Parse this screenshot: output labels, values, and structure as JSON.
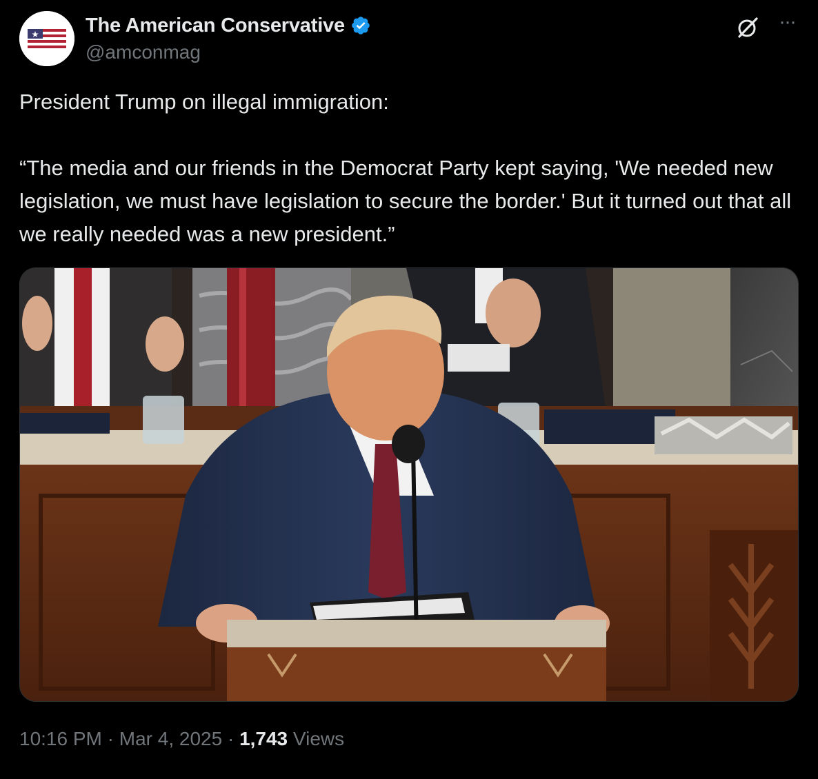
{
  "account": {
    "display_name": "The American Conservative",
    "handle": "@amconmag",
    "verified_badge_color": "#1d9bf0",
    "avatar_icon": "american-flag-logo"
  },
  "header_actions": {
    "grok_icon": "grok-icon",
    "more_icon": "more-options-icon",
    "more_label": "···"
  },
  "tweet": {
    "line1": "President Trump on illegal immigration:",
    "quote": "“The media and our friends in the Democrat Party kept saying, 'We needed new legislation, we must have legislation to secure the border.' But it turned out that all we really needed was a new president.”"
  },
  "media": {
    "type": "photo",
    "alt_subject": "speaker-at-podium"
  },
  "footer": {
    "time": "10:16 PM",
    "separator": "·",
    "date": "Mar 4, 2025",
    "views_count": "1,743",
    "views_label": "Views"
  },
  "colors": {
    "background": "#000000",
    "primary_text": "#e7e9ea",
    "secondary_text": "#71767b",
    "border": "#2f3336"
  }
}
